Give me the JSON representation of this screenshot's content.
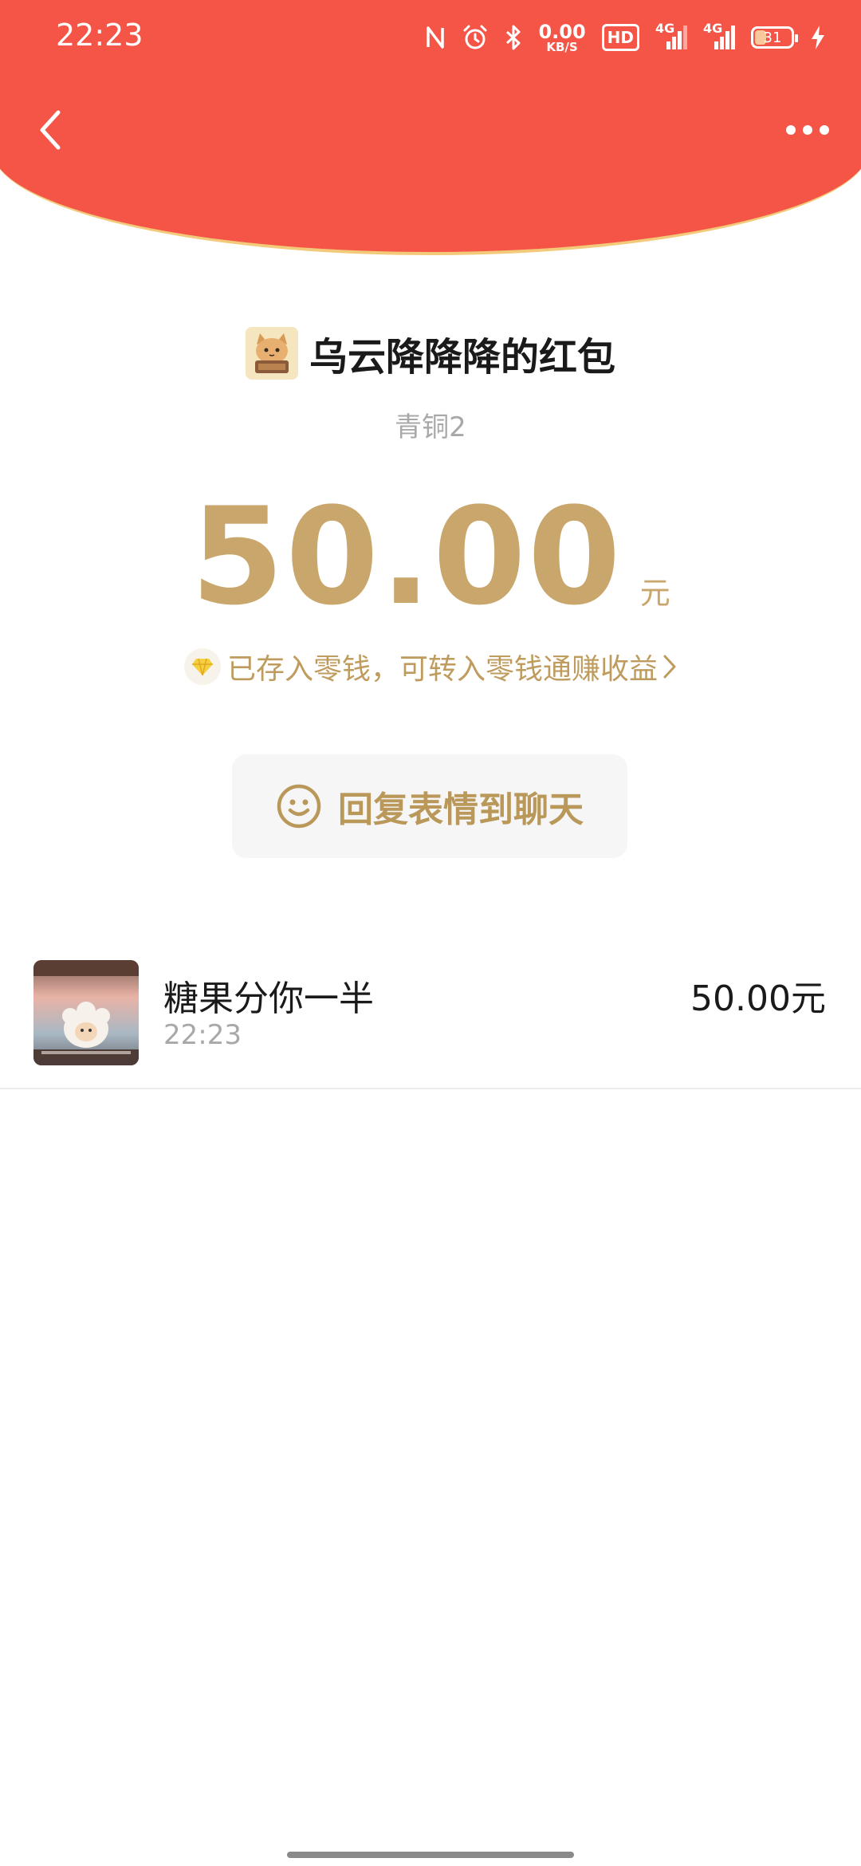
{
  "status_bar": {
    "time": "22:23",
    "net_speed_value": "0.00",
    "net_speed_unit": "KB/S",
    "hd_label": "HD",
    "signal1_label": "4G",
    "signal2_label": "4G",
    "battery_level": "31",
    "battery_fraction": 0.31,
    "icons": [
      "nfc-icon",
      "alarm-icon",
      "bluetooth-icon",
      "signal-icon",
      "charging-icon"
    ]
  },
  "nav": {
    "back_icon": "back-chevron-icon",
    "more_icon": "more-dots-icon"
  },
  "sender": {
    "title": "乌云降降降的红包",
    "level": "青铜2"
  },
  "amount": {
    "value": "50.00",
    "unit": "元"
  },
  "notice": {
    "text": "已存入零钱，可转入零钱通赚收益",
    "icon": "diamond-icon"
  },
  "reply": {
    "label": "回复表情到聊天",
    "icon": "smiley-icon"
  },
  "record": {
    "name": "糖果分你一半",
    "time": "22:23",
    "amount": "50.00元"
  },
  "colors": {
    "header_red": "#f45546",
    "header_border": "#f3c97a",
    "gold": "#c9a66b",
    "reply_gold": "#b9985a",
    "reply_bg": "#f6f6f6"
  }
}
